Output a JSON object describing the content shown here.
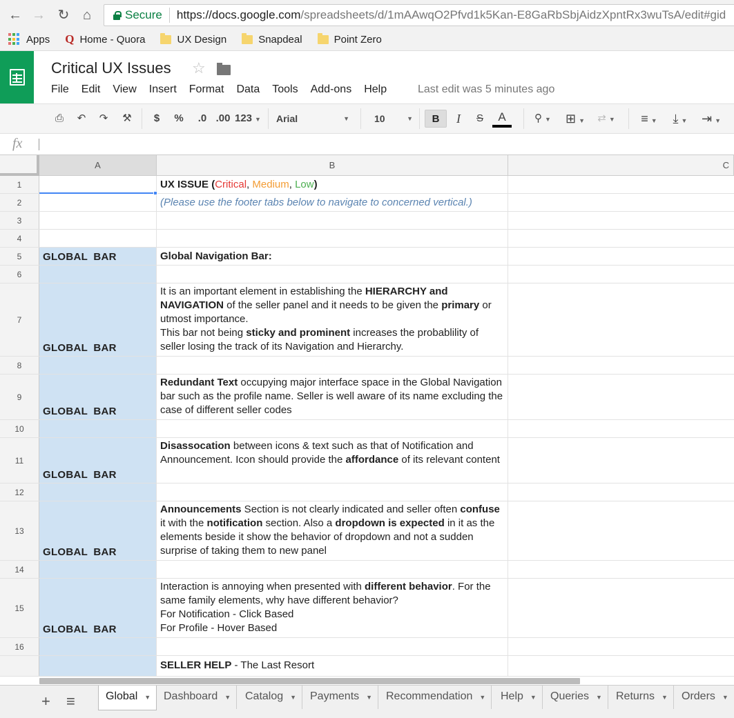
{
  "browser": {
    "secure_label": "Secure",
    "url_host": "https://docs.google.com",
    "url_path": "/spreadsheets/d/1mAAwqO2Pfvd1k5Kan-E8GaRbSbjAidzXpntRx3wuTsA/edit#gid",
    "bookmarks": [
      "Apps",
      "Home - Quora",
      "UX Design",
      "Snapdeal",
      "Point Zero"
    ]
  },
  "doc": {
    "title": "Critical UX Issues",
    "menu": [
      "File",
      "Edit",
      "View",
      "Insert",
      "Format",
      "Data",
      "Tools",
      "Add-ons",
      "Help"
    ],
    "last_edit": "Last edit was 5 minutes ago"
  },
  "toolbar": {
    "currency": "$",
    "percent": "%",
    "dec_less": ".0",
    "dec_more": ".00",
    "format_more": "123",
    "font": "Arial",
    "font_size": "10",
    "bold": "B",
    "italic": "I",
    "strike": "S",
    "text_color": "A"
  },
  "formula_bar": {
    "fx": "fx"
  },
  "columns": [
    "A",
    "B",
    "C"
  ],
  "cells": {
    "a_label": "GLOBAL  BAR",
    "r1_title": "UX ISSUE",
    "r1_open": " (",
    "r1_critical": "Critical",
    "r1_comma1": ", ",
    "r1_medium": "Medium",
    "r1_comma2": ", ",
    "r1_low": "Low",
    "r1_close": ")",
    "r2": "(Please use the footer tabs below to navigate to concerned vertical.)",
    "r5": "Global Navigation Bar:",
    "r7_1": "It is an important element in establishing the ",
    "r7_2": "HIERARCHY and NAVIGATION",
    "r7_3": " of the seller panel and it needs to be given the ",
    "r7_4": "primary",
    "r7_5": " or utmost importance.",
    "r7_6": "This bar not being ",
    "r7_7": "sticky and prominent",
    "r7_8": " increases the probablility of seller losing the track of its Navigation and Hierarchy.",
    "r9_1": "Redundant Text",
    "r9_2": " occupying major interface space in the Global Navigation bar such as the profile name. Seller is well aware of its name excluding the case of different seller codes",
    "r11_1": "Disassocation",
    "r11_2": " between icons & text such as that of Notification and Announcement. Icon should provide the ",
    "r11_3": "affordance",
    "r11_4": " of its relevant content",
    "r13_1": "Announcements",
    "r13_2": " Section is not clearly indicated and seller often ",
    "r13_3": "confuse",
    "r13_4": " it with the ",
    "r13_5": "notification",
    "r13_6": " section. Also a ",
    "r13_7": "dropdown is expected",
    "r13_8": " in it as the elements beside it show the behavior of dropdown and not a sudden surprise of taking them to new panel",
    "r15_1": "Interaction is annoying when presented with ",
    "r15_2": "different behavior",
    "r15_3": ". For the same family elements, why have different behavior?",
    "r15_4": "For Notification - Click Based",
    "r15_5": "For Profile - Hover Based",
    "r17_1": "SELLER HELP",
    "r17_2": " - The Last Resort"
  },
  "row_numbers": [
    "1",
    "2",
    "3",
    "4",
    "5",
    "6",
    "7",
    "8",
    "9",
    "10",
    "11",
    "12",
    "13",
    "14",
    "15",
    "16"
  ],
  "sheet_tabs": [
    "Global",
    "Dashboard",
    "Catalog",
    "Payments",
    "Recommendation",
    "Help",
    "Queries",
    "Returns",
    "Orders"
  ],
  "colors": {
    "critical": "#e53935",
    "medium": "#f39c34",
    "low": "#4caf50",
    "brand": "#0f9d58",
    "selected_col": "#cfe2f3"
  }
}
